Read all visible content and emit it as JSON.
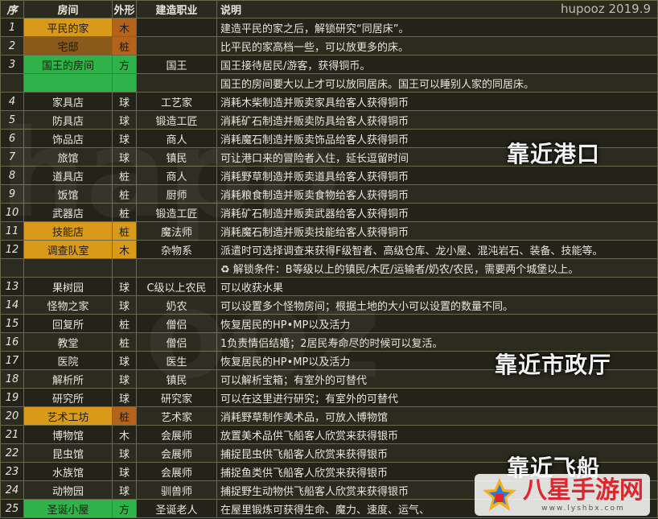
{
  "header": {
    "idx": "序",
    "room": "房间",
    "shape": "外形",
    "job": "建造职业",
    "note": "说明",
    "credit": "hupooz 2019.9"
  },
  "rows": [
    {
      "idx": "1",
      "room": "平民的家",
      "shape": "木",
      "job": "",
      "note": "建造平民的家之后，解锁研究“同居床”。"
    },
    {
      "idx": "2",
      "room": "宅邸",
      "shape": "桩",
      "job": "",
      "note": "比平民的家高档一些，可以放更多的床。"
    },
    {
      "idx": "3",
      "room": "国王的房间",
      "shape": "方",
      "job": "国王",
      "note": "国王接待居民/游客，获得铜币。"
    },
    {
      "idx": "",
      "room": "",
      "shape": "",
      "job": "",
      "note": "国王的房间要大以上才可以放同居床。国王可以睡别人家的同居床。"
    },
    {
      "idx": "4",
      "room": "家具店",
      "shape": "球",
      "job": "工艺家",
      "note": "消耗木柴制造并贩卖家具给客人获得铜币"
    },
    {
      "idx": "5",
      "room": "防具店",
      "shape": "球",
      "job": "锻造工匠",
      "note": "消耗矿石制造并贩卖防具给客人获得铜币"
    },
    {
      "idx": "6",
      "room": "饰品店",
      "shape": "球",
      "job": "商人",
      "note": "消耗魔石制造并贩卖饰品给客人获得铜币"
    },
    {
      "idx": "7",
      "room": "旅馆",
      "shape": "球",
      "job": "镇民",
      "note": "可让港口来的冒险者入住，延长逗留时间"
    },
    {
      "idx": "8",
      "room": "道具店",
      "shape": "桩",
      "job": "商人",
      "note": "消耗野草制造并贩卖道具给客人获得铜币"
    },
    {
      "idx": "9",
      "room": "饭馆",
      "shape": "桩",
      "job": "厨师",
      "note": "消耗粮食制造并贩卖食物给客人获得铜币"
    },
    {
      "idx": "10",
      "room": "武器店",
      "shape": "桩",
      "job": "锻造工匠",
      "note": "消耗矿石制造并贩卖武器给客人获得铜币"
    },
    {
      "idx": "11",
      "room": "技能店",
      "shape": "桩",
      "job": "魔法师",
      "note": "消耗魔石制造并贩卖技能给客人获得铜币"
    },
    {
      "idx": "12",
      "room": "调查队室",
      "shape": "木",
      "job": "杂物系",
      "note": "派遣时可选择调查来获得F级智者、高级仓库、龙小屋、混沌岩石、装备、技能等。"
    },
    {
      "idx": "",
      "room": "",
      "shape": "",
      "job": "",
      "note": "♻ 解锁条件：B等级以上的镇民/木匠/运输者/奶农/农民，需要两个城堡以上。"
    },
    {
      "idx": "13",
      "room": "果树园",
      "shape": "球",
      "job": "C级以上农民",
      "note": "可以收获水果"
    },
    {
      "idx": "14",
      "room": "怪物之家",
      "shape": "球",
      "job": "奶农",
      "note": "可以设置多个怪物房间；根据土地的大小可以设置的数量不同。"
    },
    {
      "idx": "15",
      "room": "回复所",
      "shape": "桩",
      "job": "僧侣",
      "note": "恢复居民的HP•MP以及活力"
    },
    {
      "idx": "16",
      "room": "教堂",
      "shape": "桩",
      "job": "僧侣",
      "note": "1负责情侣结婚；2居民寿命尽的时候可以复活。"
    },
    {
      "idx": "17",
      "room": "医院",
      "shape": "球",
      "job": "医生",
      "note": "恢复居民的HP•MP以及活力"
    },
    {
      "idx": "18",
      "room": "解析所",
      "shape": "球",
      "job": "镇民",
      "note": "可以解析宝箱；有室外的可替代"
    },
    {
      "idx": "19",
      "room": "研究所",
      "shape": "球",
      "job": "研究家",
      "note": "可以在这里进行研究；有室外的可替代"
    },
    {
      "idx": "20",
      "room": "艺术工坊",
      "shape": "桩",
      "job": "艺术家",
      "note": "消耗野草制作美术品，可放入博物馆"
    },
    {
      "idx": "21",
      "room": "博物馆",
      "shape": "木",
      "job": "会展师",
      "note": "放置美术品供飞船客人欣赏来获得银币"
    },
    {
      "idx": "22",
      "room": "昆虫馆",
      "shape": "球",
      "job": "会展师",
      "note": "捕捉昆虫供飞船客人欣赏来获得银币"
    },
    {
      "idx": "23",
      "room": "水族馆",
      "shape": "球",
      "job": "会展师",
      "note": "捕捉鱼类供飞船客人欣赏来获得银币"
    },
    {
      "idx": "24",
      "room": "动物园",
      "shape": "球",
      "job": "驯兽师",
      "note": "捕捉野生动物供飞船客人欣赏来获得银币"
    },
    {
      "idx": "25",
      "room": "圣诞小屋",
      "shape": "方",
      "job": "圣诞老人",
      "note": "在屋里锻炼可获得生命、魔力、速度、运气、"
    }
  ],
  "overlays": {
    "port": "靠近港口",
    "hall": "靠近市政厅",
    "ship": "靠近飞船"
  },
  "logo": {
    "text": "八星手游网",
    "url": "www.lyshbx.com"
  },
  "colors": {
    "room_orange": "#d99a1a",
    "room_brown": "#8a5a1a",
    "room_green": "#2fb24a",
    "shape_brown": "#b5621a",
    "shape_orange": "#d99a1a"
  }
}
